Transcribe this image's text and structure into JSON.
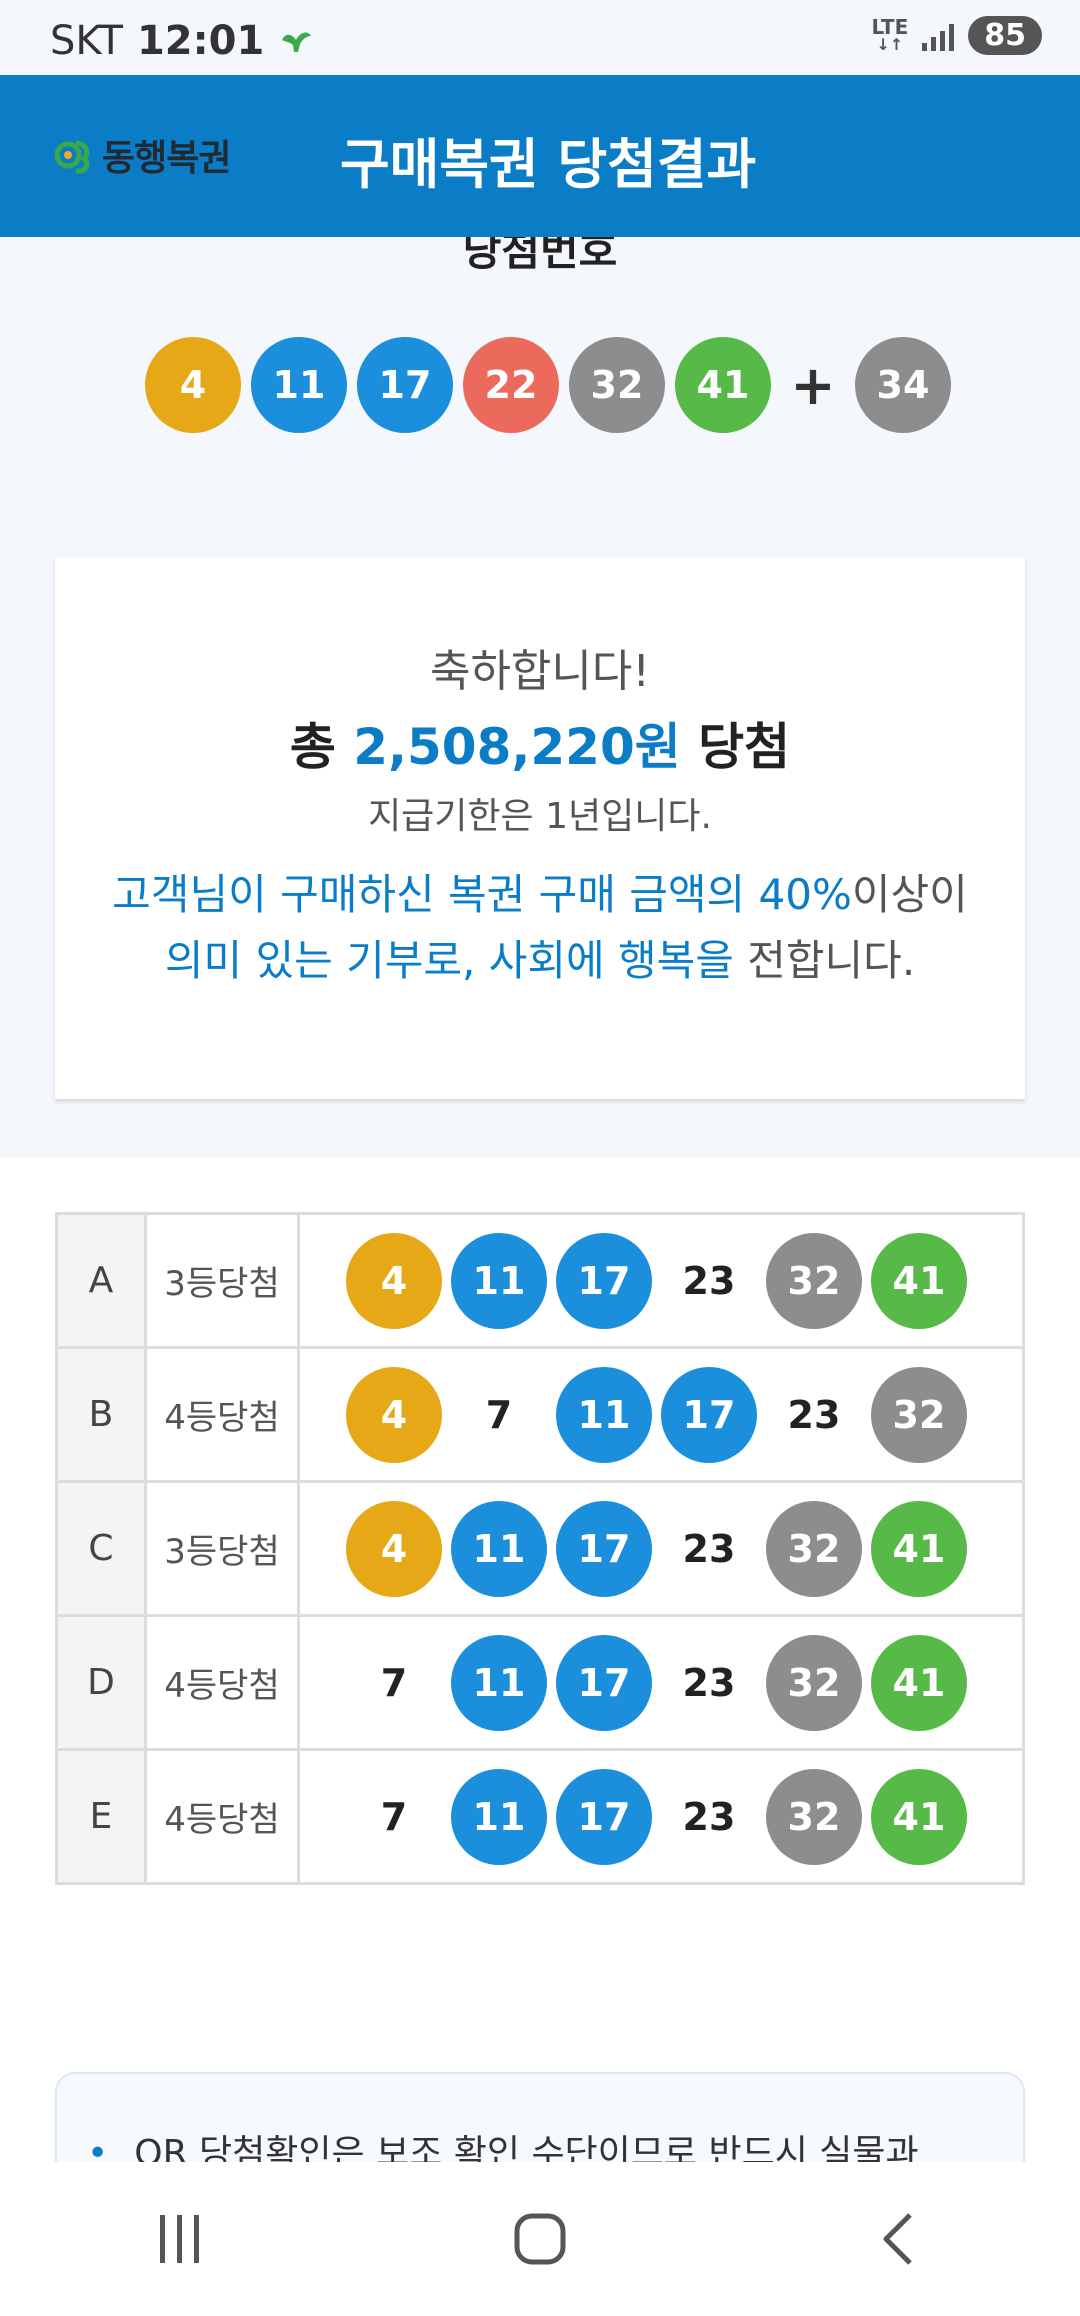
{
  "status_bar": {
    "carrier": "SKT",
    "time": "12:01",
    "network": "LTE",
    "battery": "85",
    "icons": [
      "bird-notification-icon",
      "signal-icon"
    ]
  },
  "app_bar": {
    "logo_text": "동행복권",
    "title": "구매복권 당첨결과"
  },
  "winning": {
    "label": "당첨번호",
    "numbers": [
      {
        "value": "4",
        "color": "#e6a817"
      },
      {
        "value": "11",
        "color": "#1b8fdc"
      },
      {
        "value": "17",
        "color": "#1b8fdc"
      },
      {
        "value": "22",
        "color": "#ec6a5c"
      },
      {
        "value": "32",
        "color": "#8d8d8d"
      },
      {
        "value": "41",
        "color": "#57b947"
      }
    ],
    "plus": "+",
    "bonus": {
      "value": "34",
      "color": "#8d8d8d"
    }
  },
  "summary": {
    "congrats": "축하합니다!",
    "total_prefix": "총 ",
    "total_amount": "2,508,220원",
    "total_suffix": " 당첨",
    "deadline": "지급기한은 1년입니다.",
    "donate_line1_blue": "고객님이 구매하신 복권 구매 금액의 40%",
    "donate_line1_rest": "이상이",
    "donate_line2_blue": "의미 있는 기부로, 사회에 행복을",
    "donate_line2_rest": " 전합니다."
  },
  "results": [
    {
      "letter": "A",
      "rank": "3등당첨",
      "numbers": [
        {
          "value": "4",
          "color": "#e6a817"
        },
        {
          "value": "11",
          "color": "#1b8fdc"
        },
        {
          "value": "17",
          "color": "#1b8fdc"
        },
        {
          "value": "23",
          "color": ""
        },
        {
          "value": "32",
          "color": "#8d8d8d"
        },
        {
          "value": "41",
          "color": "#57b947"
        }
      ]
    },
    {
      "letter": "B",
      "rank": "4등당첨",
      "numbers": [
        {
          "value": "4",
          "color": "#e6a817"
        },
        {
          "value": "7",
          "color": ""
        },
        {
          "value": "11",
          "color": "#1b8fdc"
        },
        {
          "value": "17",
          "color": "#1b8fdc"
        },
        {
          "value": "23",
          "color": ""
        },
        {
          "value": "32",
          "color": "#8d8d8d"
        }
      ]
    },
    {
      "letter": "C",
      "rank": "3등당첨",
      "numbers": [
        {
          "value": "4",
          "color": "#e6a817"
        },
        {
          "value": "11",
          "color": "#1b8fdc"
        },
        {
          "value": "17",
          "color": "#1b8fdc"
        },
        {
          "value": "23",
          "color": ""
        },
        {
          "value": "32",
          "color": "#8d8d8d"
        },
        {
          "value": "41",
          "color": "#57b947"
        }
      ]
    },
    {
      "letter": "D",
      "rank": "4등당첨",
      "numbers": [
        {
          "value": "7",
          "color": ""
        },
        {
          "value": "11",
          "color": "#1b8fdc"
        },
        {
          "value": "17",
          "color": "#1b8fdc"
        },
        {
          "value": "23",
          "color": ""
        },
        {
          "value": "32",
          "color": "#8d8d8d"
        },
        {
          "value": "41",
          "color": "#57b947"
        }
      ]
    },
    {
      "letter": "E",
      "rank": "4등당첨",
      "numbers": [
        {
          "value": "7",
          "color": ""
        },
        {
          "value": "11",
          "color": "#1b8fdc"
        },
        {
          "value": "17",
          "color": "#1b8fdc"
        },
        {
          "value": "23",
          "color": ""
        },
        {
          "value": "32",
          "color": "#8d8d8d"
        },
        {
          "value": "41",
          "color": "#57b947"
        }
      ]
    }
  ],
  "notice": {
    "bullet": "•",
    "text": "QR 당첨확인은 보조 확인 수단이므로 반드시 실물과"
  },
  "nav": {
    "icons": [
      "recent-apps-icon",
      "home-icon",
      "back-icon"
    ]
  }
}
